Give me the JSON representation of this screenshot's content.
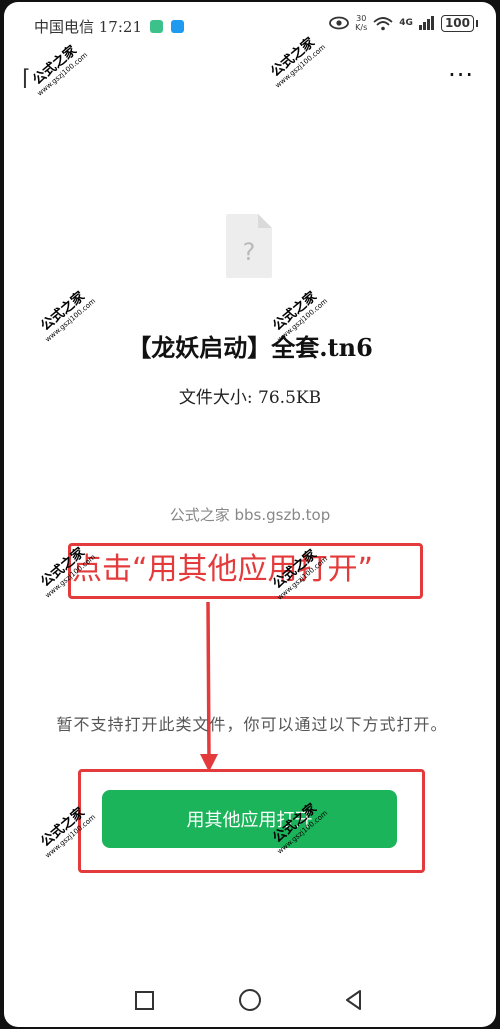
{
  "status": {
    "carrier_time": "中国电信 17:21",
    "net_speed": "30\nK/s",
    "net_type": "4G",
    "battery": "100"
  },
  "file": {
    "icon_glyph": "?",
    "name": "【龙妖启动】全套.tn6",
    "size": "文件大小: 76.5KB"
  },
  "brand_text": "公式之家 bbs.gszb.top",
  "annotation": "点击“用其他应用打开”",
  "unsupported_text": "暂不支持打开此类文件，你可以通过以下方式打开。",
  "open_button": "用其他应用打开",
  "watermark": {
    "main": "公式之家",
    "url": "www.gszj100.com"
  },
  "colors": {
    "accent_green": "#1bb45a",
    "annotation_red": "#e33b3b"
  }
}
